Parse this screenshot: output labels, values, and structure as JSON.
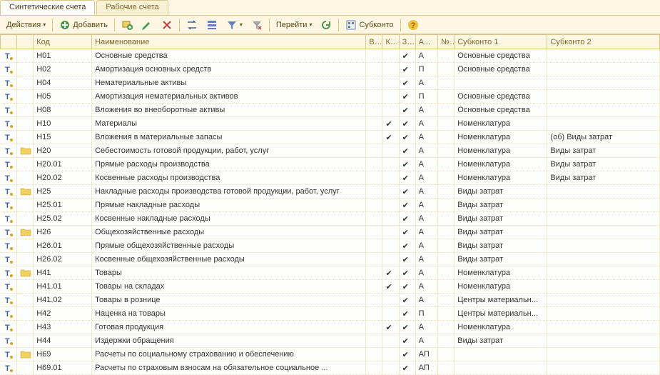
{
  "tabs": [
    {
      "label": "Синтетические счета",
      "active": true
    },
    {
      "label": "Рабочие счета",
      "active": false
    }
  ],
  "toolbar": {
    "actions": "Действия",
    "add": "Добавить",
    "go": "Перейти",
    "subkonto": "Субконто"
  },
  "columns": {
    "code": "Код",
    "name": "Наименование",
    "v": "В...",
    "k": "К...",
    "z": "З...",
    "a": "А...",
    "n": "№..",
    "s1": "Субконто 1",
    "s2": "Субконто 2"
  },
  "rows": [
    {
      "folder": false,
      "code": "Н01",
      "name": "Основные средства",
      "v": "",
      "k": "",
      "z": "✔",
      "a": "А",
      "s1": "Основные средства",
      "s2": ""
    },
    {
      "folder": false,
      "code": "Н02",
      "name": "Амортизация основных средств",
      "v": "",
      "k": "",
      "z": "✔",
      "a": "П",
      "s1": "Основные средства",
      "s2": ""
    },
    {
      "folder": false,
      "code": "Н04",
      "name": "Нематериальные активы",
      "v": "",
      "k": "",
      "z": "✔",
      "a": "А",
      "s1": "",
      "s2": ""
    },
    {
      "folder": false,
      "code": "Н05",
      "name": "Амортизация нематериальных активов",
      "v": "",
      "k": "",
      "z": "✔",
      "a": "П",
      "s1": "Основные средства",
      "s2": ""
    },
    {
      "folder": false,
      "code": "Н08",
      "name": "Вложения во внеоборотные активы",
      "v": "",
      "k": "",
      "z": "✔",
      "a": "А",
      "s1": "Основные средства",
      "s2": ""
    },
    {
      "folder": false,
      "code": "Н10",
      "name": "Материалы",
      "v": "",
      "k": "✔",
      "z": "✔",
      "a": "А",
      "s1": "Номенклатура",
      "s2": ""
    },
    {
      "folder": false,
      "code": "Н15",
      "name": "Вложения в материальные запасы",
      "v": "",
      "k": "✔",
      "z": "✔",
      "a": "А",
      "s1": "Номенклатура",
      "s2": "(об) Виды затрат"
    },
    {
      "folder": true,
      "code": "Н20",
      "name": "Себестоимость готовой продукции, работ, услуг",
      "v": "",
      "k": "",
      "z": "✔",
      "a": "А",
      "s1": "Номенклатура",
      "s2": "Виды затрат"
    },
    {
      "folder": false,
      "code": "Н20.01",
      "name": "Прямые расходы производства",
      "v": "",
      "k": "",
      "z": "✔",
      "a": "А",
      "s1": "Номенклатура",
      "s2": "Виды затрат"
    },
    {
      "folder": false,
      "code": "Н20.02",
      "name": "Косвенные расходы производства",
      "v": "",
      "k": "",
      "z": "✔",
      "a": "А",
      "s1": "Номенклатура",
      "s2": "Виды затрат"
    },
    {
      "folder": true,
      "code": "Н25",
      "name": "Накладные расходы производства готовой продукции, работ, услуг",
      "v": "",
      "k": "",
      "z": "✔",
      "a": "А",
      "s1": "Виды затрат",
      "s2": ""
    },
    {
      "folder": false,
      "code": "Н25.01",
      "name": "Прямые накладные расходы",
      "v": "",
      "k": "",
      "z": "✔",
      "a": "А",
      "s1": "Виды затрат",
      "s2": ""
    },
    {
      "folder": false,
      "code": "Н25.02",
      "name": "Косвенные накладные расходы",
      "v": "",
      "k": "",
      "z": "✔",
      "a": "А",
      "s1": "Виды затрат",
      "s2": ""
    },
    {
      "folder": true,
      "code": "Н26",
      "name": "Общехозяйственные расходы",
      "v": "",
      "k": "",
      "z": "✔",
      "a": "А",
      "s1": "Виды затрат",
      "s2": ""
    },
    {
      "folder": false,
      "code": "Н26.01",
      "name": "Прямые общехозяйственные расходы",
      "v": "",
      "k": "",
      "z": "✔",
      "a": "А",
      "s1": "Виды затрат",
      "s2": ""
    },
    {
      "folder": false,
      "code": "Н26.02",
      "name": "Косвенные общехозяйственные расходы",
      "v": "",
      "k": "",
      "z": "✔",
      "a": "А",
      "s1": "Виды затрат",
      "s2": ""
    },
    {
      "folder": true,
      "code": "Н41",
      "name": "Товары",
      "v": "",
      "k": "✔",
      "z": "✔",
      "a": "А",
      "s1": "Номенклатура",
      "s2": ""
    },
    {
      "folder": false,
      "code": "Н41.01",
      "name": "Товары на складах",
      "v": "",
      "k": "✔",
      "z": "✔",
      "a": "А",
      "s1": "Номенклатура",
      "s2": ""
    },
    {
      "folder": false,
      "code": "Н41.02",
      "name": "Товары в рознице",
      "v": "",
      "k": "",
      "z": "✔",
      "a": "А",
      "s1": "Центры материальн...",
      "s2": ""
    },
    {
      "folder": false,
      "code": "Н42",
      "name": "Наценка на товары",
      "v": "",
      "k": "",
      "z": "✔",
      "a": "П",
      "s1": "Центры материальн...",
      "s2": ""
    },
    {
      "folder": false,
      "code": "Н43",
      "name": "Готовая продукция",
      "v": "",
      "k": "✔",
      "z": "✔",
      "a": "А",
      "s1": "Номенклатура",
      "s2": ""
    },
    {
      "folder": false,
      "code": "Н44",
      "name": "Издержки обращения",
      "v": "",
      "k": "",
      "z": "✔",
      "a": "А",
      "s1": "Виды затрат",
      "s2": ""
    },
    {
      "folder": true,
      "code": "Н69",
      "name": "Расчеты по социальному страхованию и обеспечению",
      "v": "",
      "k": "",
      "z": "✔",
      "a": "АП",
      "s1": "",
      "s2": ""
    },
    {
      "folder": false,
      "code": "Н69.01",
      "name": "Расчеты по страховым взносам на обязательное социальное ...",
      "v": "",
      "k": "",
      "z": "✔",
      "a": "АП",
      "s1": "",
      "s2": ""
    }
  ]
}
